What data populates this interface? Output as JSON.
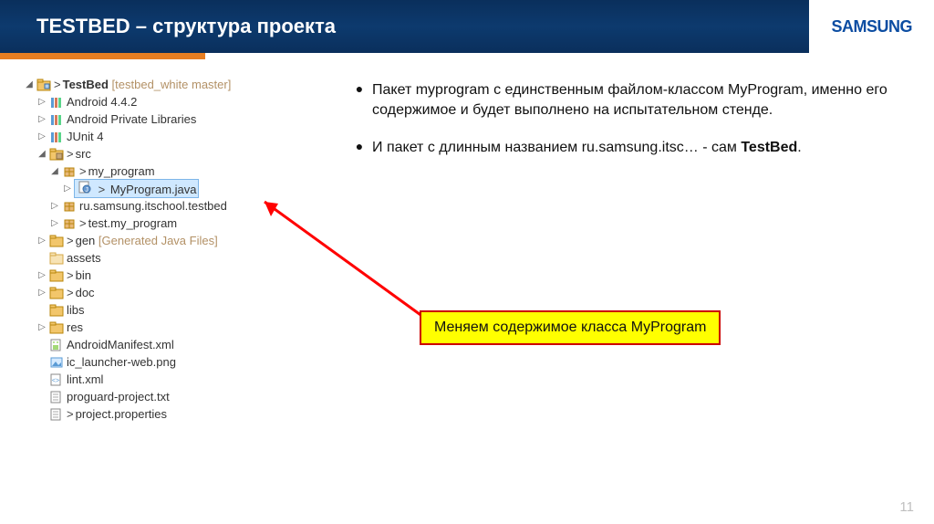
{
  "header": {
    "title": "TESTBED – структура проекта",
    "logo": "SAMSUNG"
  },
  "tree": {
    "root": {
      "name": "TestBed",
      "decor": "[testbed_white master]"
    },
    "android": "Android 4.4.2",
    "apl": "Android Private Libraries",
    "junit": "JUnit 4",
    "src": "src",
    "mypkg": "my_program",
    "myfile": "MyProgram.java",
    "rupkg": "ru.samsung.itschool.testbed",
    "testpkg": "test.my_program",
    "gen": {
      "name": "gen",
      "decor": "[Generated Java Files]"
    },
    "assets": "assets",
    "bin": "bin",
    "doc": "doc",
    "libs": "libs",
    "res": "res",
    "manifest": "AndroidManifest.xml",
    "iclaunch": "ic_launcher-web.png",
    "lint": "lint.xml",
    "proguard": "proguard-project.txt",
    "projprop": "project.properties"
  },
  "bullets": {
    "b1a": "Пакет myprogram с единственным файлом-классом MyProgram, именно его содержимое и будет выполнено на испытательном стенде.",
    "b2a": "И пакет с длинным названием ru.samsung.itsc… - сам ",
    "b2b": "TestBed",
    "b2c": "."
  },
  "callout": "Меняем содержимое класса MyProgram",
  "page": "11"
}
